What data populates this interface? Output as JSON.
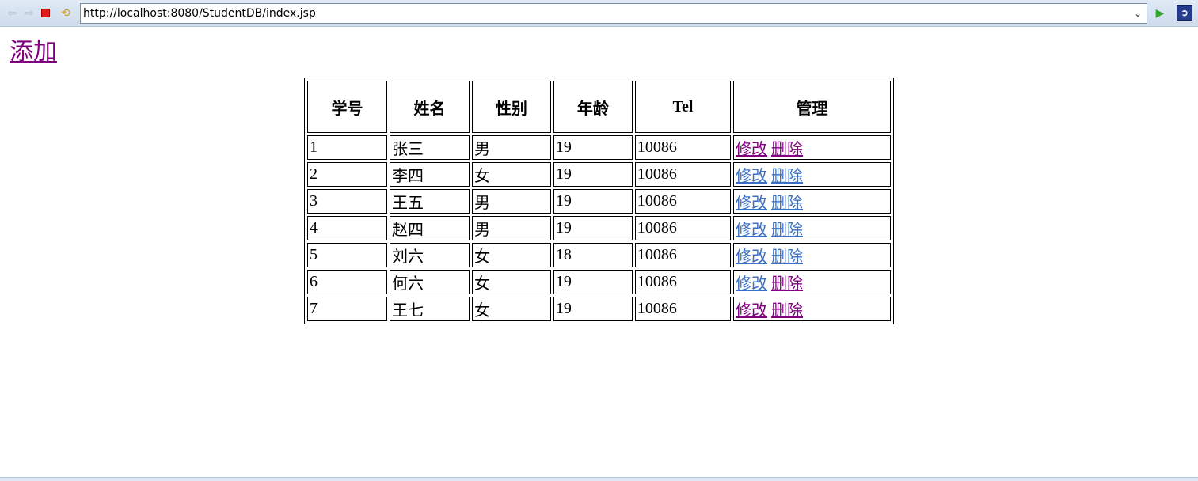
{
  "browser": {
    "url": "http://localhost:8080/StudentDB/index.jsp",
    "icons": {
      "back": "back-arrow-icon",
      "forward": "forward-arrow-icon",
      "stop": "stop-icon",
      "refresh": "refresh-icon",
      "dropdown": "chevron-down-icon",
      "go": "play-icon",
      "extension": "extension-icon"
    }
  },
  "page": {
    "add_label": "添加",
    "table": {
      "headers": [
        "学号",
        "姓名",
        "性别",
        "年龄",
        "Tel",
        "管理"
      ],
      "rows": [
        {
          "id": "1",
          "name": "张三",
          "gender": "男",
          "age": "19",
          "tel": "10086",
          "edit": "修改",
          "delete": "删除",
          "edit_visited": true,
          "delete_visited": true
        },
        {
          "id": "2",
          "name": "李四",
          "gender": "女",
          "age": "19",
          "tel": "10086",
          "edit": "修改",
          "delete": "删除",
          "edit_visited": false,
          "delete_visited": false
        },
        {
          "id": "3",
          "name": "王五",
          "gender": "男",
          "age": "19",
          "tel": "10086",
          "edit": "修改",
          "delete": "删除",
          "edit_visited": false,
          "delete_visited": false
        },
        {
          "id": "4",
          "name": "赵四",
          "gender": "男",
          "age": "19",
          "tel": "10086",
          "edit": "修改",
          "delete": "删除",
          "edit_visited": false,
          "delete_visited": false
        },
        {
          "id": "5",
          "name": "刘六",
          "gender": "女",
          "age": "18",
          "tel": "10086",
          "edit": "修改",
          "delete": "删除",
          "edit_visited": false,
          "delete_visited": false
        },
        {
          "id": "6",
          "name": "何六",
          "gender": "女",
          "age": "19",
          "tel": "10086",
          "edit": "修改",
          "delete": "删除",
          "edit_visited": false,
          "delete_visited": true
        },
        {
          "id": "7",
          "name": "王七",
          "gender": "女",
          "age": "19",
          "tel": "10086",
          "edit": "修改",
          "delete": "删除",
          "edit_visited": true,
          "delete_visited": true
        }
      ]
    }
  },
  "colors": {
    "visited_link": "#800080",
    "unvisited_link": "#3a6fc4"
  }
}
